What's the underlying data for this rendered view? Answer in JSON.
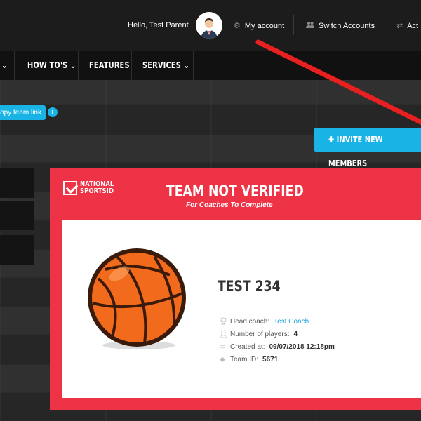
{
  "header": {
    "greeting": "Hello, Test Parent",
    "items": [
      {
        "icon": "gear-icon",
        "label": "My account"
      },
      {
        "icon": "users-icon",
        "label": "Switch Accounts"
      },
      {
        "icon": "swap-icon",
        "label": "Act"
      }
    ]
  },
  "nav": {
    "items": [
      {
        "label": "HOW TO'S",
        "chevron": "⌄"
      },
      {
        "label": "FEATURES"
      },
      {
        "label": "SERVICES",
        "chevron": "⌄"
      }
    ]
  },
  "copy_link": {
    "label": "opy team link"
  },
  "invite_button": {
    "label": "INVITE NEW MEMBERS"
  },
  "card": {
    "logo_line1": "NATIONAL",
    "logo_line2": "SPORTSID",
    "title": "TEAM NOT VERIFIED",
    "subtitle": "For Coaches To Complete",
    "team_name": "TEST 234",
    "head_coach_label": "Head coach:",
    "head_coach": "Test Coach",
    "players_label": "Number of players:",
    "players": "4",
    "created_label": "Created at:",
    "created": "09/07/2018 12:18pm",
    "team_id_label": "Team ID:",
    "team_id": "5671"
  },
  "colors": {
    "accent": "#19b3e6",
    "card_red": "#ee3346",
    "arrow_red": "#e8201f"
  }
}
